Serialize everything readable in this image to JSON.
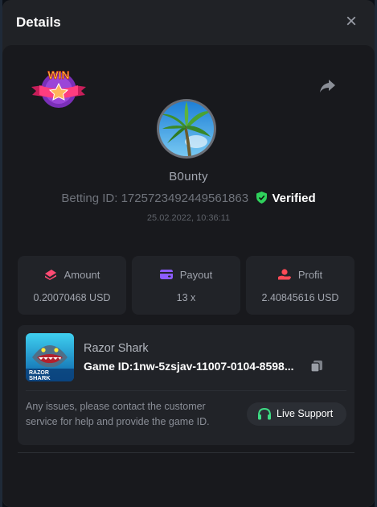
{
  "header": {
    "title": "Details",
    "close_glyph": "×"
  },
  "badge": {
    "text": "WIN",
    "icon": "win-badge-icon"
  },
  "player": {
    "username": "B0unty",
    "betting_id_label": "Betting ID:",
    "betting_id": "1725723492449561863",
    "verified_label": "Verified",
    "datetime": "25.02.2022, 10:36:11"
  },
  "stats": [
    {
      "label": "Amount",
      "value": "0.20070468 USD",
      "icon": "coins-icon",
      "color": "#ff4a73"
    },
    {
      "label": "Payout",
      "value": "13 x",
      "icon": "wallet-icon",
      "color": "#8c5cff"
    },
    {
      "label": "Profit",
      "value": "2.40845616 USD",
      "icon": "hand-coin-icon",
      "color": "#ff4a56"
    }
  ],
  "game": {
    "name": "Razor Shark",
    "id_label": "Game ID:",
    "id": "1nw-5zsjav-11007-0104-8598...",
    "thumb_line1": "RAZOR",
    "thumb_line2": "SHARK"
  },
  "support": {
    "text": "Any issues, please contact the customer service for help and provide the game ID.",
    "button_label": "Live Support"
  },
  "colors": {
    "accent_green": "#3ddc84",
    "verified_green": "#2fd15c",
    "panel_bg": "#18191d",
    "card_bg": "#212328"
  }
}
